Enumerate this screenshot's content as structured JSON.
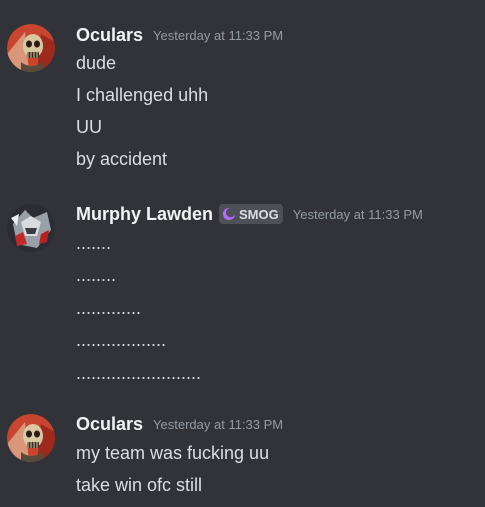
{
  "colors": {
    "background": "#313338",
    "username": "#f2f3f5",
    "message_text": "#dbdee1",
    "timestamp": "#949ba4",
    "tag_bg": "#4e5058",
    "tag_icon": "#b56bff"
  },
  "messages": [
    {
      "author": "Oculars",
      "avatar": "skull-avatar-icon",
      "timestamp": "Yesterday at 11:33 PM",
      "lines": [
        "dude",
        "I challenged uhh",
        "UU",
        "by accident"
      ]
    },
    {
      "author": "Murphy Lawden",
      "avatar": "armored-avatar-icon",
      "tag": {
        "icon": "crescent-moon-icon",
        "label": "SMOG"
      },
      "timestamp": "Yesterday at 11:33 PM",
      "lines": [
        ".......",
        "........",
        ".............",
        "..................",
        "........................."
      ]
    },
    {
      "author": "Oculars",
      "avatar": "skull-avatar-icon",
      "timestamp": "Yesterday at 11:33 PM",
      "lines": [
        "my team was fucking uu",
        "take win ofc still"
      ]
    }
  ]
}
